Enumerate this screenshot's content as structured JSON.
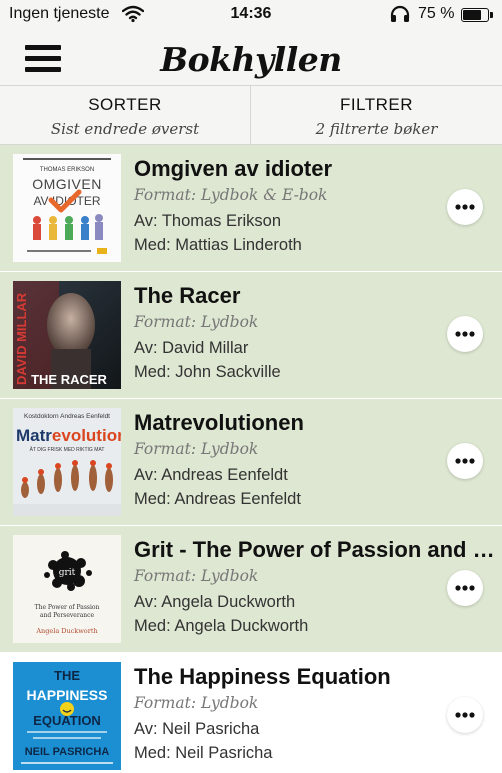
{
  "status_bar": {
    "carrier": "Ingen tjeneste",
    "time": "14:36",
    "battery_percent": "75 %",
    "battery_level": 0.75,
    "icons": [
      "wifi-icon",
      "headphones-icon",
      "battery-icon"
    ]
  },
  "header": {
    "menu_icon": "hamburger-menu-icon",
    "title": "Bokhyllen"
  },
  "controls": {
    "sort": {
      "label": "SORTER",
      "value": "Sist endrede øverst"
    },
    "filter": {
      "label": "FILTRER",
      "value": "2 filtrerte bøker"
    }
  },
  "books": [
    {
      "title": "Omgiven av idioter",
      "format": "Format: Lydbok & E-bok",
      "author": "Av: Thomas Erikson",
      "narrator": "Med: Mattias Linderoth",
      "selected": true,
      "cover": {
        "top_text": "THOMAS ERIKSON",
        "line1": "OMGIVEN",
        "line2": "AV IDIOTER",
        "accent": "#e8672a"
      }
    },
    {
      "title": "The Racer",
      "format": "Format: Lydbok",
      "author": "Av: David Millar",
      "narrator": "Med: John Sackville",
      "selected": true,
      "cover": {
        "side_text": "DAVID MILLAR",
        "bottom_text": "THE RACER",
        "accent": "#d63a34"
      }
    },
    {
      "title": "Matrevolutionen",
      "format": "Format: Lydbok",
      "author": "Av: Andreas Eenfeldt",
      "narrator": "Med: Andreas Eenfeldt",
      "selected": true,
      "cover": {
        "top_text": "Kostdoktorn Andreas Eenfeldt",
        "title_a": "Matr",
        "title_b": "evolution",
        "title_c": "en",
        "subtitle": "ÄT DIG FRISK MED RIKTIG MAT",
        "accent": "#d9461f"
      }
    },
    {
      "title": "Grit - The Power of Passion and Perseverance",
      "format": "Format: Lydbok",
      "author": "Av: Angela Duckworth",
      "narrator": "Med: Angela Duckworth",
      "selected": true,
      "cover": {
        "word": "grit",
        "subtitle_1": "The Power of Passion",
        "subtitle_2": "and Perseverance",
        "author": "Angela Duckworth",
        "accent": "#b04a2e"
      }
    },
    {
      "title": "The Happiness Equation",
      "format": "Format: Lydbok",
      "author": "Av: Neil Pasricha",
      "narrator": "Med: Neil Pasricha",
      "selected": false,
      "cover": {
        "line1": "THE",
        "line2": "HAPPINESS",
        "line3": "EQUATION",
        "author": "NEIL PASRICHA",
        "accent": "#f2d21a",
        "background": "#1b8fd2"
      }
    }
  ],
  "colors": {
    "selected_row": "#dde7d1",
    "header_bg": "#f5f5f3",
    "muted_text": "#777777"
  }
}
